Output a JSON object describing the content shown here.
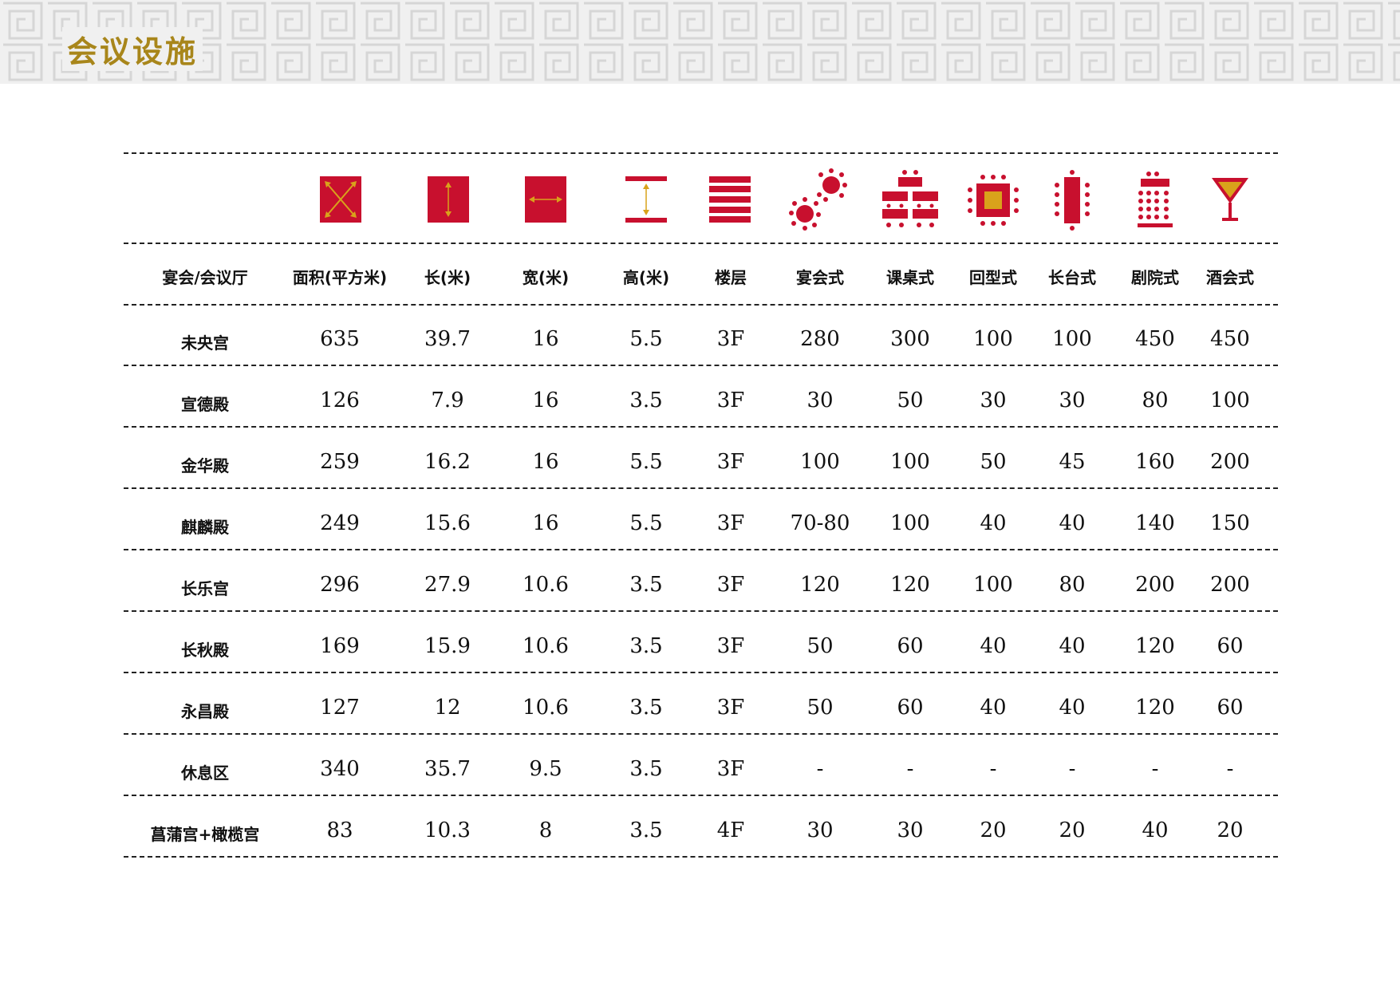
{
  "page": {
    "title": "会议设施"
  },
  "colors": {
    "red": "#c8102e",
    "gold": "#d9a21b",
    "title_gold": "#a8861b"
  },
  "icons": [
    "area-icon",
    "length-icon",
    "width-icon",
    "height-icon",
    "floor-icon",
    "banquet-icon",
    "classroom-icon",
    "u-shape-icon",
    "boardroom-icon",
    "theater-icon",
    "cocktail-icon"
  ],
  "columns": [
    "宴会/会议厅",
    "面积(平方米)",
    "长(米)",
    "宽(米)",
    "高(米)",
    "楼层",
    "宴会式",
    "课桌式",
    "回型式",
    "长台式",
    "剧院式",
    "酒会式"
  ],
  "rows": [
    [
      "未央宫",
      "635",
      "39.7",
      "16",
      "5.5",
      "3F",
      "280",
      "300",
      "100",
      "100",
      "450",
      "450"
    ],
    [
      "宣德殿",
      "126",
      "7.9",
      "16",
      "3.5",
      "3F",
      "30",
      "50",
      "30",
      "30",
      "80",
      "100"
    ],
    [
      "金华殿",
      "259",
      "16.2",
      "16",
      "5.5",
      "3F",
      "100",
      "100",
      "50",
      "45",
      "160",
      "200"
    ],
    [
      "麒麟殿",
      "249",
      "15.6",
      "16",
      "5.5",
      "3F",
      "70-80",
      "100",
      "40",
      "40",
      "140",
      "150"
    ],
    [
      "长乐宫",
      "296",
      "27.9",
      "10.6",
      "3.5",
      "3F",
      "120",
      "120",
      "100",
      "80",
      "200",
      "200"
    ],
    [
      "长秋殿",
      "169",
      "15.9",
      "10.6",
      "3.5",
      "3F",
      "50",
      "60",
      "40",
      "40",
      "120",
      "60"
    ],
    [
      "永昌殿",
      "127",
      "12",
      "10.6",
      "3.5",
      "3F",
      "50",
      "60",
      "40",
      "40",
      "120",
      "60"
    ],
    [
      "休息区",
      "340",
      "35.7",
      "9.5",
      "3.5",
      "3F",
      "-",
      "-",
      "-",
      "-",
      "-",
      "-"
    ],
    [
      "菖蒲宫+橄榄宫",
      "83",
      "10.3",
      "8",
      "3.5",
      "4F",
      "30",
      "30",
      "20",
      "20",
      "40",
      "20"
    ]
  ]
}
